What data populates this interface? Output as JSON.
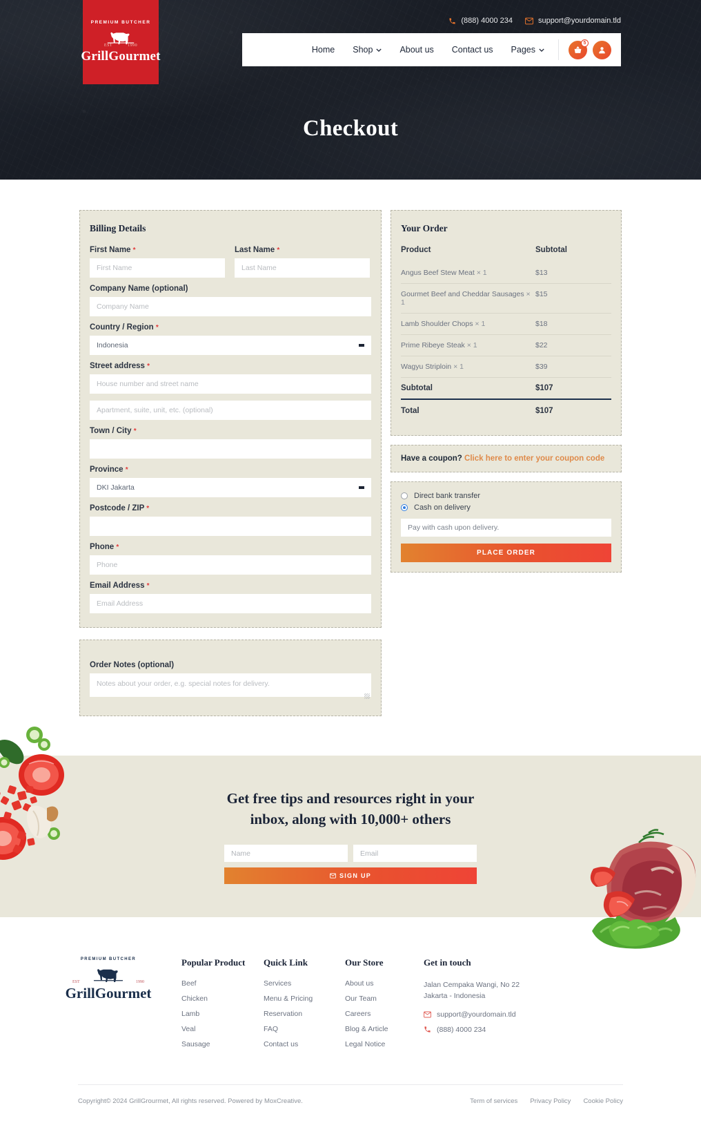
{
  "brand": {
    "tagline": "PREMIUM BUTCHER",
    "est_left": "EST",
    "est_right": "1990",
    "name": "GrillGourmet",
    "accent": "#cf2027",
    "cta_gradient_from": "#e2822f",
    "cta_gradient_to": "#ef4436",
    "panel_bg": "#e9e7da",
    "dark": "#1b2437"
  },
  "topbar": {
    "phone": "(888) 4000 234",
    "email": "support@yourdomain.tld"
  },
  "nav": {
    "items": [
      {
        "label": "Home",
        "has_dropdown": false
      },
      {
        "label": "Shop",
        "has_dropdown": true
      },
      {
        "label": "About us",
        "has_dropdown": false
      },
      {
        "label": "Contact us",
        "has_dropdown": false
      },
      {
        "label": "Pages",
        "has_dropdown": true
      }
    ],
    "cart_count": "5"
  },
  "hero": {
    "title": "Checkout"
  },
  "billing": {
    "title": "Billing Details",
    "first_name": {
      "label": "First Name",
      "required": true,
      "placeholder": "First Name",
      "value": ""
    },
    "last_name": {
      "label": "Last Name",
      "required": true,
      "placeholder": "Last Name",
      "value": ""
    },
    "company": {
      "label": "Company Name (optional)",
      "required": false,
      "placeholder": "Company Name",
      "value": ""
    },
    "country": {
      "label": "Country / Region",
      "required": true,
      "value": "Indonesia"
    },
    "street": {
      "label": "Street address",
      "required": true,
      "placeholder": "House number and street name",
      "value": ""
    },
    "street2": {
      "placeholder": "Apartment, suite, unit, etc. (optional)",
      "value": ""
    },
    "city": {
      "label": "Town / City",
      "required": true,
      "placeholder": "",
      "value": ""
    },
    "province": {
      "label": "Province",
      "required": true,
      "value": "DKI Jakarta"
    },
    "postcode": {
      "label": "Postcode / ZIP",
      "required": true,
      "placeholder": "",
      "value": ""
    },
    "phone": {
      "label": "Phone",
      "required": true,
      "placeholder": "Phone",
      "value": ""
    },
    "email": {
      "label": "Email Address",
      "required": true,
      "placeholder": "Email Address",
      "value": ""
    }
  },
  "notes": {
    "label": "Order Notes (optional)",
    "placeholder": "Notes about your order, e.g. special notes for delivery.",
    "value": ""
  },
  "order": {
    "title": "Your Order",
    "col_product": "Product",
    "col_subtotal": "Subtotal",
    "items": [
      {
        "name": "Angus Beef Stew Meat",
        "qty": "× 1",
        "price": "$13"
      },
      {
        "name": "Gourmet Beef and Cheddar Sausages",
        "qty": "× 1",
        "price": "$15"
      },
      {
        "name": "Lamb Shoulder Chops",
        "qty": "× 1",
        "price": "$18"
      },
      {
        "name": "Prime Ribeye Steak",
        "qty": "× 1",
        "price": "$22"
      },
      {
        "name": "Wagyu Striploin",
        "qty": "× 1",
        "price": "$39"
      }
    ],
    "subtotal_label": "Subtotal",
    "subtotal_value": "$107",
    "total_label": "Total",
    "total_value": "$107"
  },
  "coupon": {
    "prompt": "Have a coupon?",
    "link": "Click here to enter your coupon code"
  },
  "payment": {
    "options": [
      {
        "label": "Direct bank transfer",
        "selected": false
      },
      {
        "label": "Cash on delivery",
        "selected": true
      }
    ],
    "description": "Pay with cash upon delivery.",
    "place_order_label": "PLACE ORDER"
  },
  "newsletter": {
    "title_line1": "Get free tips and resources right in your",
    "title_line2": "inbox, along with 10,000+ others",
    "name_placeholder": "Name",
    "email_placeholder": "Email",
    "button_label": "SIGN UP"
  },
  "footer": {
    "columns": [
      {
        "heading": "Popular Product",
        "links": [
          "Beef",
          "Chicken",
          "Lamb",
          "Veal",
          "Sausage"
        ]
      },
      {
        "heading": "Quick Link",
        "links": [
          "Services",
          "Menu & Pricing",
          "Reservation",
          "FAQ",
          "Contact us"
        ]
      },
      {
        "heading": "Our Store",
        "links": [
          "About us",
          "Our Team",
          "Careers",
          "Blog & Article",
          "Legal Notice"
        ]
      }
    ],
    "contact": {
      "heading": "Get in touch",
      "address_line1": "Jalan Cempaka Wangi, No 22",
      "address_line2": "Jakarta - Indonesia",
      "email": "support@yourdomain.tld",
      "phone": "(888) 4000 234"
    },
    "copyright": "Copyright© 2024 GrillGrourmet, All rights reserved. Powered by MoxCreative.",
    "legal_links": [
      "Term of services",
      "Privacy Policy",
      "Cookie Policy"
    ]
  }
}
